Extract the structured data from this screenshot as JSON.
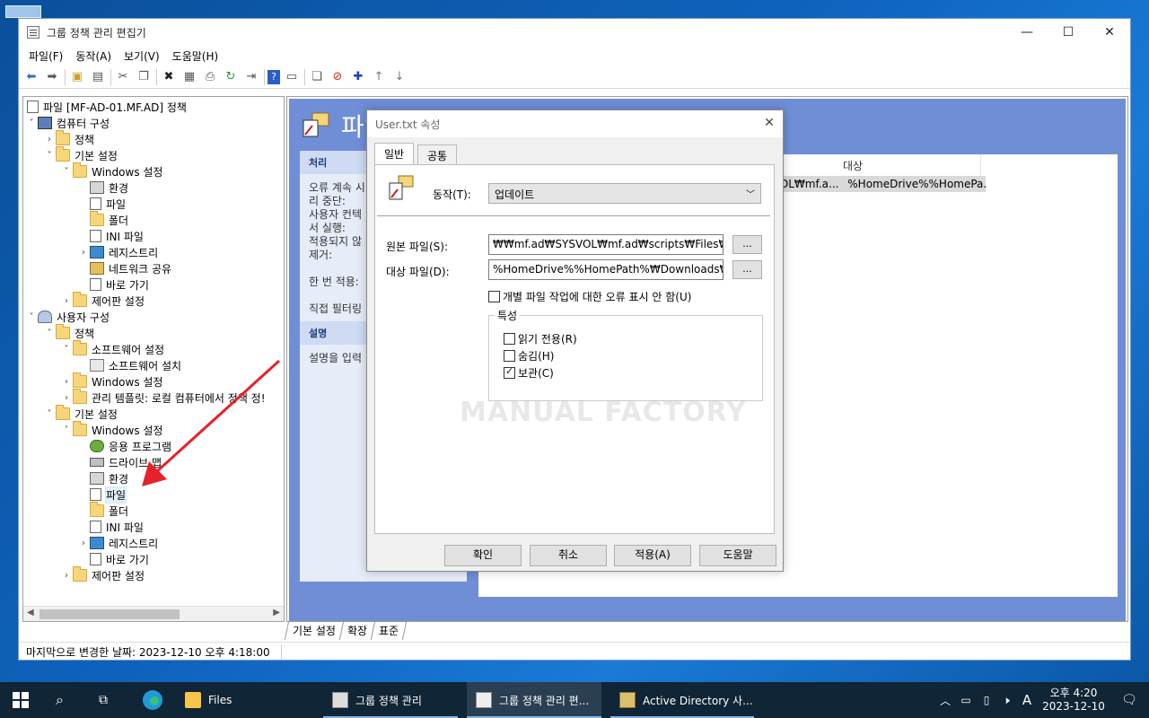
{
  "window": {
    "title": "그룹 정책 관리 편집기",
    "menu": [
      "파일(F)",
      "동작(A)",
      "보기(V)",
      "도움말(H)"
    ]
  },
  "tree": {
    "root": "파일 [MF-AD-01.MF.AD] 정책",
    "computer_config": "컴퓨터 구성",
    "c_policy": "정책",
    "c_prefs": "기본 설정",
    "c_winsettings": "Windows 설정",
    "c_env": "환경",
    "c_files": "파일",
    "c_folders": "폴더",
    "c_ini": "INI 파일",
    "c_registry": "레지스트리",
    "c_netshare": "네트워크 공유",
    "c_shortcut": "바로 가기",
    "c_controlpanel": "제어판 설정",
    "user_config": "사용자 구성",
    "u_policy": "정책",
    "u_software": "소프트웨어 설정",
    "u_software_install": "소프트웨어 설치",
    "u_winsettings": "Windows 설정",
    "u_admtemplates": "관리 템플릿: 로컬 컴퓨터에서 정책 정!",
    "u_prefs": "기본 설정",
    "u_pref_winsettings": "Windows 설정",
    "u_apps": "응용 프로그램",
    "u_drivemaps": "드라이브 맵",
    "u_env": "환경",
    "u_files": "파일",
    "u_folders": "폴더",
    "u_ini": "INI 파일",
    "u_registry": "레지스트리",
    "u_shortcut": "바로 가기",
    "u_controlpanel": "제어판 설정"
  },
  "rightpane": {
    "title": "파일",
    "processing_head": "처리",
    "processing_text": "오류 계속 시\n리 중단:\n사용자 컨텍\n서 실행:\n적용되지 않\n제거:\n\n한 번 적용:\n\n직접 필터링",
    "description_head": "설명",
    "description_text": "설명을 입력",
    "col_target": "대상",
    "row_partial": "DL₩mf.a...",
    "row_target": "%HomeDrive%%HomePa..."
  },
  "bottom_tabs": [
    "기본 설정",
    "확장",
    "표준"
  ],
  "status": "마지막으로 변경한 날짜: 2023-12-10 오후 4:18:00",
  "dialog": {
    "title": "User.txt 속성",
    "tab_general": "일반",
    "tab_common": "공통",
    "action_label": "동작(T):",
    "action_value": "업데이트",
    "source_label": "원본 파일(S):",
    "source_value": "₩₩mf.ad₩SYSVOL₩mf.ad₩scripts₩Files₩User.t",
    "target_label": "대상 파일(D):",
    "target_value": "%HomeDrive%%HomePath%₩Downloads₩Tem",
    "browse": "...",
    "suppress_errors": "개별 파일 작업에 대한 오류 표시 안 함(U)",
    "attributes": "특성",
    "readonly": "읽기 전용(R)",
    "hidden": "숨김(H)",
    "archive": "보관(C)",
    "watermark": "MANUAL FACTORY",
    "ok": "확인",
    "cancel": "취소",
    "apply": "적용(A)",
    "help": "도움말"
  },
  "taskbar": {
    "apps": [
      "Files",
      "그룹 정책 관리",
      "그룹 정책 관리 편...",
      "Active Directory 사..."
    ],
    "time": "오후 4:20",
    "date": "2023-12-10",
    "ime": "A"
  },
  "colors": {
    "pane_blue": "#6f8ed6",
    "taskbar": "#102535",
    "arrow": "#e8202a"
  }
}
